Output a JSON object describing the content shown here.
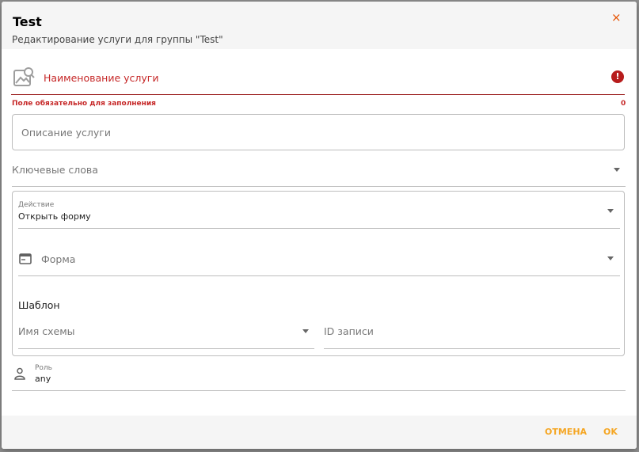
{
  "dialog": {
    "title": "Test",
    "subtitle": "Редактирование услуги для группы \"Test\"",
    "close_label": "×"
  },
  "service_name": {
    "label": "Наименование услуги",
    "error_icon": "!",
    "error_text": "Поле обязательно для заполнения",
    "counter": "0"
  },
  "description": {
    "placeholder": "Описание услуги"
  },
  "keywords": {
    "placeholder": "Ключевые слова"
  },
  "action": {
    "label": "Действие",
    "value": "Открыть форму",
    "form_placeholder": "Форма",
    "template_title": "Шаблон",
    "scheme_placeholder": "Имя схемы",
    "record_id_placeholder": "ID записи"
  },
  "role": {
    "label": "Роль",
    "value": "any"
  },
  "footer": {
    "cancel_label": "ОТМЕНА",
    "ok_label": "OK"
  },
  "colors": {
    "accent": "#f5a623",
    "error": "#c62828",
    "close": "#e65100"
  },
  "icons": [
    "image-search-icon",
    "error-icon",
    "form-icon",
    "person-icon",
    "dropdown-arrow-icon",
    "close-icon"
  ]
}
